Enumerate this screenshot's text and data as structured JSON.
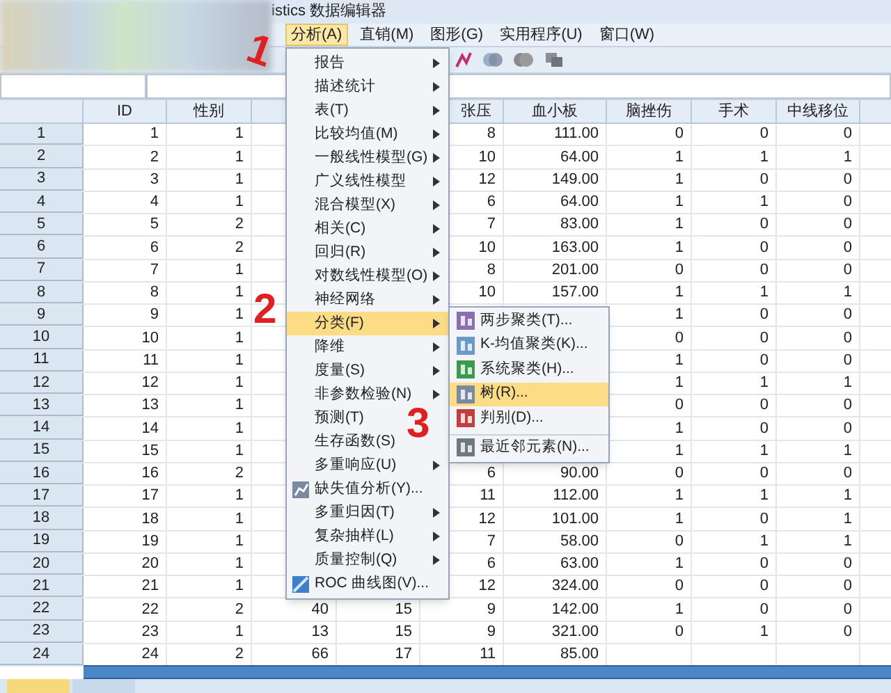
{
  "window": {
    "title": "istics 数据编辑器"
  },
  "menubar": [
    {
      "label": "分析(A)",
      "selected": true
    },
    {
      "label": "直销(M)",
      "selected": false
    },
    {
      "label": "图形(G)",
      "selected": false
    },
    {
      "label": "实用程序(U)",
      "selected": false
    },
    {
      "label": "窗口(W)",
      "selected": false
    }
  ],
  "table": {
    "columns": [
      "ID",
      "性别",
      null,
      null,
      "张压",
      "血小板",
      "脑挫伤",
      "手术",
      "中线移位",
      null
    ],
    "rows": [
      {
        "number": "1",
        "cells": [
          "1",
          "1",
          null,
          null,
          "8",
          "111.00",
          "0",
          "0",
          "0"
        ]
      },
      {
        "number": "2",
        "cells": [
          "2",
          "1",
          null,
          null,
          "10",
          "64.00",
          "1",
          "1",
          "1"
        ]
      },
      {
        "number": "3",
        "cells": [
          "3",
          "1",
          null,
          null,
          "12",
          "149.00",
          "1",
          "0",
          "0"
        ]
      },
      {
        "number": "4",
        "cells": [
          "4",
          "1",
          null,
          null,
          "6",
          "64.00",
          "1",
          "1",
          "0"
        ]
      },
      {
        "number": "5",
        "cells": [
          "5",
          "2",
          null,
          null,
          "7",
          "83.00",
          "1",
          "0",
          "0"
        ]
      },
      {
        "number": "6",
        "cells": [
          "6",
          "2",
          null,
          null,
          "10",
          "163.00",
          "1",
          "0",
          "0"
        ]
      },
      {
        "number": "7",
        "cells": [
          "7",
          "1",
          null,
          null,
          "8",
          "201.00",
          "0",
          "0",
          "0"
        ]
      },
      {
        "number": "8",
        "cells": [
          "8",
          "1",
          null,
          null,
          "10",
          "157.00",
          "1",
          "1",
          "1"
        ]
      },
      {
        "number": "9",
        "cells": [
          "9",
          "1",
          null,
          null,
          null,
          null,
          "1",
          "0",
          "0"
        ]
      },
      {
        "number": "10",
        "cells": [
          "10",
          "1",
          null,
          null,
          null,
          null,
          "0",
          "0",
          "0"
        ]
      },
      {
        "number": "11",
        "cells": [
          "11",
          "1",
          null,
          null,
          null,
          null,
          "1",
          "0",
          "0"
        ]
      },
      {
        "number": "12",
        "cells": [
          "12",
          "1",
          null,
          null,
          null,
          null,
          "1",
          "1",
          "1"
        ]
      },
      {
        "number": "13",
        "cells": [
          "13",
          "1",
          null,
          null,
          null,
          null,
          "0",
          "0",
          "0"
        ]
      },
      {
        "number": "14",
        "cells": [
          "14",
          "1",
          null,
          null,
          null,
          null,
          "1",
          "0",
          "0"
        ]
      },
      {
        "number": "15",
        "cells": [
          "15",
          "1",
          null,
          null,
          null,
          null,
          "1",
          "1",
          "1"
        ]
      },
      {
        "number": "16",
        "cells": [
          "16",
          "2",
          null,
          null,
          "6",
          "90.00",
          "0",
          "0",
          "0"
        ]
      },
      {
        "number": "17",
        "cells": [
          "17",
          "1",
          null,
          null,
          "11",
          "112.00",
          "1",
          "1",
          "1"
        ]
      },
      {
        "number": "18",
        "cells": [
          "18",
          "1",
          null,
          null,
          "12",
          "101.00",
          "1",
          "0",
          "1"
        ]
      },
      {
        "number": "19",
        "cells": [
          "19",
          "1",
          null,
          null,
          "7",
          "58.00",
          "0",
          "1",
          "1"
        ]
      },
      {
        "number": "20",
        "cells": [
          "20",
          "1",
          null,
          null,
          "6",
          "63.00",
          "1",
          "0",
          "0"
        ]
      },
      {
        "number": "21",
        "cells": [
          "21",
          "1",
          null,
          null,
          "12",
          "324.00",
          "0",
          "0",
          "0"
        ]
      },
      {
        "number": "22",
        "cells": [
          "22",
          "2",
          "40",
          "15",
          "9",
          "142.00",
          "1",
          "0",
          "0"
        ]
      },
      {
        "number": "23",
        "cells": [
          "23",
          "1",
          "13",
          "15",
          "9",
          "321.00",
          "0",
          "1",
          "0"
        ]
      },
      {
        "number": "24",
        "cells": [
          "24",
          "2",
          "66",
          "17",
          "11",
          "85.00",
          null,
          null,
          null
        ]
      }
    ]
  },
  "menu": {
    "items": [
      {
        "label": "报告",
        "submenu": true,
        "has_icon": false,
        "selected": false
      },
      {
        "label": "描述统计",
        "submenu": true,
        "has_icon": false,
        "selected": false
      },
      {
        "label": "表(T)",
        "submenu": true,
        "has_icon": false,
        "selected": false
      },
      {
        "label": "比较均值(M)",
        "submenu": true,
        "has_icon": false,
        "selected": false
      },
      {
        "label": "一般线性模型(G)",
        "submenu": true,
        "has_icon": false,
        "selected": false
      },
      {
        "label": "广义线性模型",
        "submenu": true,
        "has_icon": false,
        "selected": false
      },
      {
        "label": "混合模型(X)",
        "submenu": true,
        "has_icon": false,
        "selected": false
      },
      {
        "label": "相关(C)",
        "submenu": true,
        "has_icon": false,
        "selected": false
      },
      {
        "label": "回归(R)",
        "submenu": true,
        "has_icon": false,
        "selected": false
      },
      {
        "label": "对数线性模型(O)",
        "submenu": true,
        "has_icon": false,
        "selected": false
      },
      {
        "label": "神经网络",
        "submenu": true,
        "has_icon": false,
        "selected": false
      },
      {
        "label": "分类(F)",
        "submenu": true,
        "has_icon": false,
        "selected": true
      },
      {
        "label": "降维",
        "submenu": true,
        "has_icon": false,
        "selected": false
      },
      {
        "label": "度量(S)",
        "submenu": true,
        "has_icon": false,
        "selected": false
      },
      {
        "label": "非参数检验(N)",
        "submenu": true,
        "has_icon": false,
        "selected": false
      },
      {
        "label": "预测(T)",
        "submenu": false,
        "has_icon": false,
        "selected": false
      },
      {
        "label": "生存函数(S)",
        "submenu": false,
        "has_icon": false,
        "selected": false
      },
      {
        "label": "多重响应(U)",
        "submenu": true,
        "has_icon": false,
        "selected": false
      },
      {
        "label": "缺失值分析(Y)...",
        "submenu": false,
        "has_icon": true,
        "selected": false
      },
      {
        "label": "多重归因(T)",
        "submenu": true,
        "has_icon": false,
        "selected": false
      },
      {
        "label": "复杂抽样(L)",
        "submenu": true,
        "has_icon": false,
        "selected": false
      },
      {
        "label": "质量控制(Q)",
        "submenu": true,
        "has_icon": false,
        "selected": false
      },
      {
        "label": "ROC 曲线图(V)...",
        "submenu": false,
        "has_icon": true,
        "selected": false
      }
    ]
  },
  "submenu": {
    "items": [
      {
        "label": "两步聚类(T)...",
        "selected": false,
        "separator_before": false
      },
      {
        "label": "K-均值聚类(K)...",
        "selected": false,
        "separator_before": false
      },
      {
        "label": "系统聚类(H)...",
        "selected": false,
        "separator_before": false
      },
      {
        "label": "树(R)...",
        "selected": true,
        "separator_before": false
      },
      {
        "label": "判别(D)...",
        "selected": false,
        "separator_before": false
      },
      {
        "label": "最近邻元素(N)...",
        "selected": false,
        "separator_before": true
      }
    ]
  },
  "annotations": [
    {
      "label": "1"
    },
    {
      "label": "2"
    },
    {
      "label": "3"
    }
  ]
}
